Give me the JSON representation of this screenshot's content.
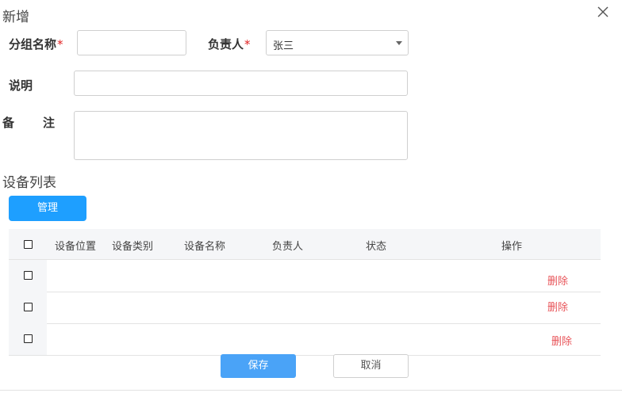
{
  "dialog": {
    "title": "新增",
    "close_icon": "close-icon"
  },
  "form": {
    "group_name_label": "分组名称",
    "owner_label": "负责人",
    "required_mark": "*",
    "owner_value": "张三",
    "description_label": "说明",
    "remark_label_1": "备",
    "remark_label_2": "注"
  },
  "devices": {
    "section_title": "设备列表",
    "manage_button": "管理",
    "columns": [
      "设备位置",
      "设备类别",
      "设备名称",
      "负责人",
      "状态",
      "操作"
    ],
    "rows": [
      {
        "action": "删除"
      },
      {
        "action": "删除"
      },
      {
        "action": "删除"
      }
    ]
  },
  "footer": {
    "save_label": "保存",
    "cancel_label": "取消"
  },
  "colors": {
    "primary": "#1e9fff",
    "save": "#4aa3f7",
    "danger": "#e8555a",
    "required": "#e02020"
  }
}
